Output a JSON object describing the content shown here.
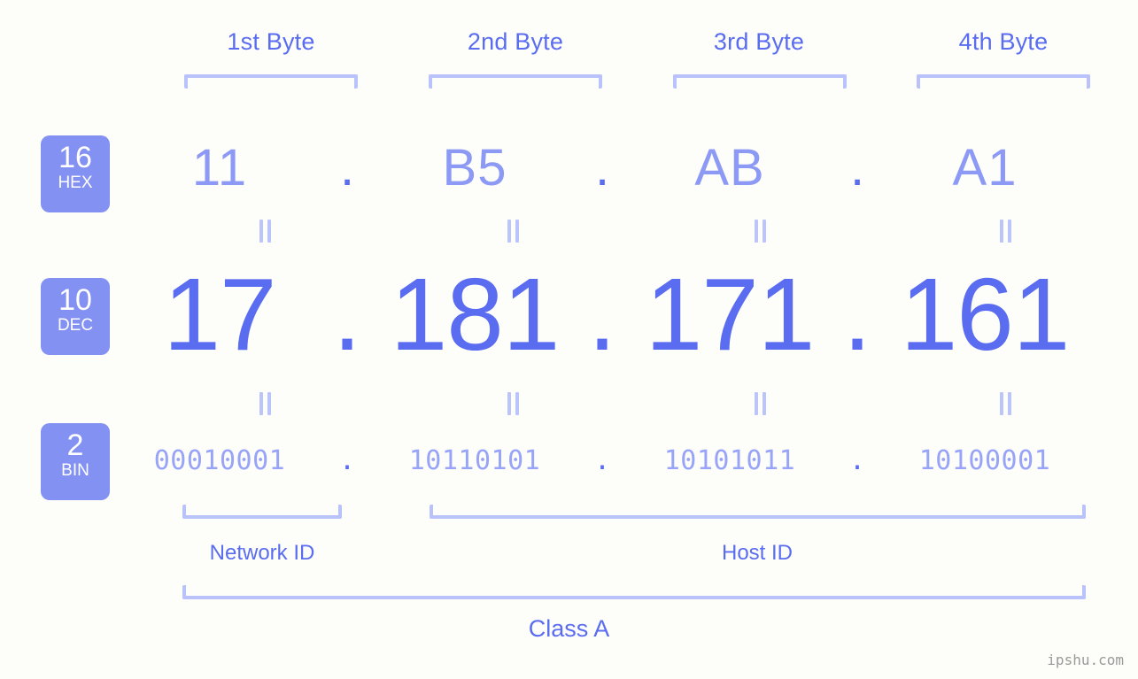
{
  "meta": {
    "background_color": "#fdfdfa",
    "accent_color": "#5a6cf0",
    "accent_light_color": "#8c99f5",
    "bracket_color": "#b9c2fb",
    "badge_color": "#8391f2",
    "watermark": "ipshu.com"
  },
  "byte_headers": [
    {
      "label": "1st Byte"
    },
    {
      "label": "2nd Byte"
    },
    {
      "label": "3rd Byte"
    },
    {
      "label": "4th Byte"
    }
  ],
  "bases": [
    {
      "number": "16",
      "abbr": "HEX"
    },
    {
      "number": "10",
      "abbr": "DEC"
    },
    {
      "number": "2",
      "abbr": "BIN"
    }
  ],
  "separator": ".",
  "equality_symbol": "=",
  "rows": {
    "hex": {
      "base": "16",
      "abbr": "HEX",
      "octets": [
        "11",
        "B5",
        "AB",
        "A1"
      ],
      "address": "11.B5.AB.A1"
    },
    "dec": {
      "base": "10",
      "abbr": "DEC",
      "octets": [
        "17",
        "181",
        "171",
        "161"
      ],
      "address": "17.181.171.161"
    },
    "bin": {
      "base": "2",
      "abbr": "BIN",
      "octets": [
        "00010001",
        "10110101",
        "10101011",
        "10100001"
      ],
      "address": "00010001.10110101.10101011.10100001"
    }
  },
  "sections": [
    {
      "label": "Network ID"
    },
    {
      "label": "Host ID"
    }
  ],
  "class": {
    "label": "Class A"
  }
}
